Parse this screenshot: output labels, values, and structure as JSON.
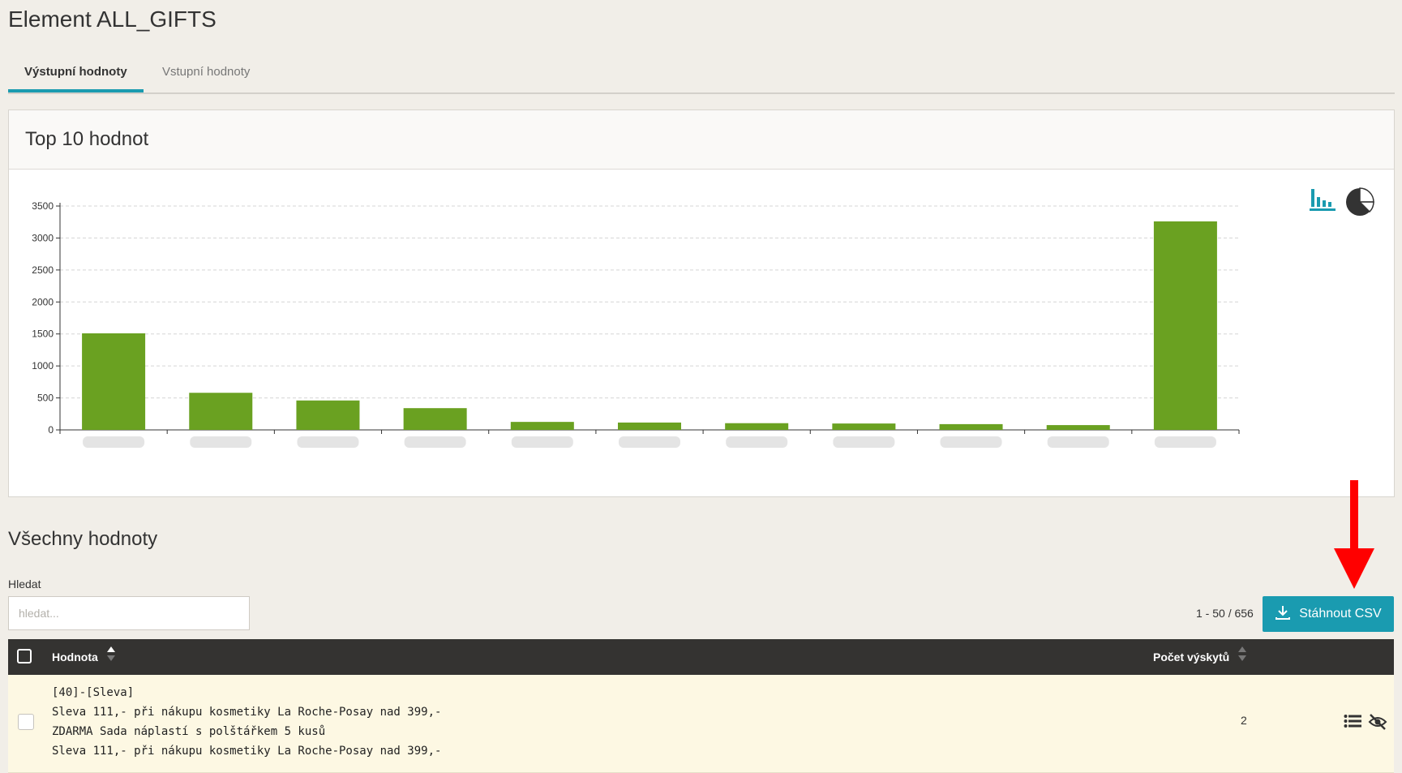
{
  "page": {
    "title": "Element ALL_GIFTS"
  },
  "tabs": [
    {
      "label": "Výstupní hodnoty",
      "active": true
    },
    {
      "label": "Vstupní hodnoty",
      "active": false
    }
  ],
  "top_card": {
    "title": "Top 10 hodnot"
  },
  "chart_data": {
    "type": "bar",
    "categories": [
      "",
      "",
      "",
      "",
      "",
      "",
      "",
      "",
      "",
      "",
      ""
    ],
    "values": [
      1510,
      580,
      460,
      340,
      125,
      115,
      105,
      100,
      90,
      75,
      3260
    ],
    "y_ticks": [
      0,
      500,
      1000,
      1500,
      2000,
      2500,
      3000,
      3500
    ],
    "ylim": [
      0,
      3500
    ],
    "grid": true,
    "bar_color": "#6aa121",
    "x_labels_blurred": true
  },
  "all_values": {
    "title": "Všechny hodnoty",
    "search_label": "Hledat",
    "search_placeholder": "hledat...",
    "pager": "1 - 50 / 656",
    "csv_button": "Stáhnout CSV",
    "columns": {
      "value": "Hodnota",
      "count": "Počet výskytů"
    },
    "rows": [
      {
        "value": "[40]-[Sleva]\nSleva 111,- při nákupu kosmetiky La Roche-Posay nad 399,-\nZDARMA Sada náplastí s polštářkem 5 kusů\nSleva 111,- při nákupu kosmetiky La Roche-Posay nad 399,-",
        "count": "2"
      }
    ]
  },
  "colors": {
    "accent": "#1a9bb0",
    "header_dark": "#343331",
    "row_highlight": "#fdf8e3",
    "annotation": "#ff0000"
  }
}
